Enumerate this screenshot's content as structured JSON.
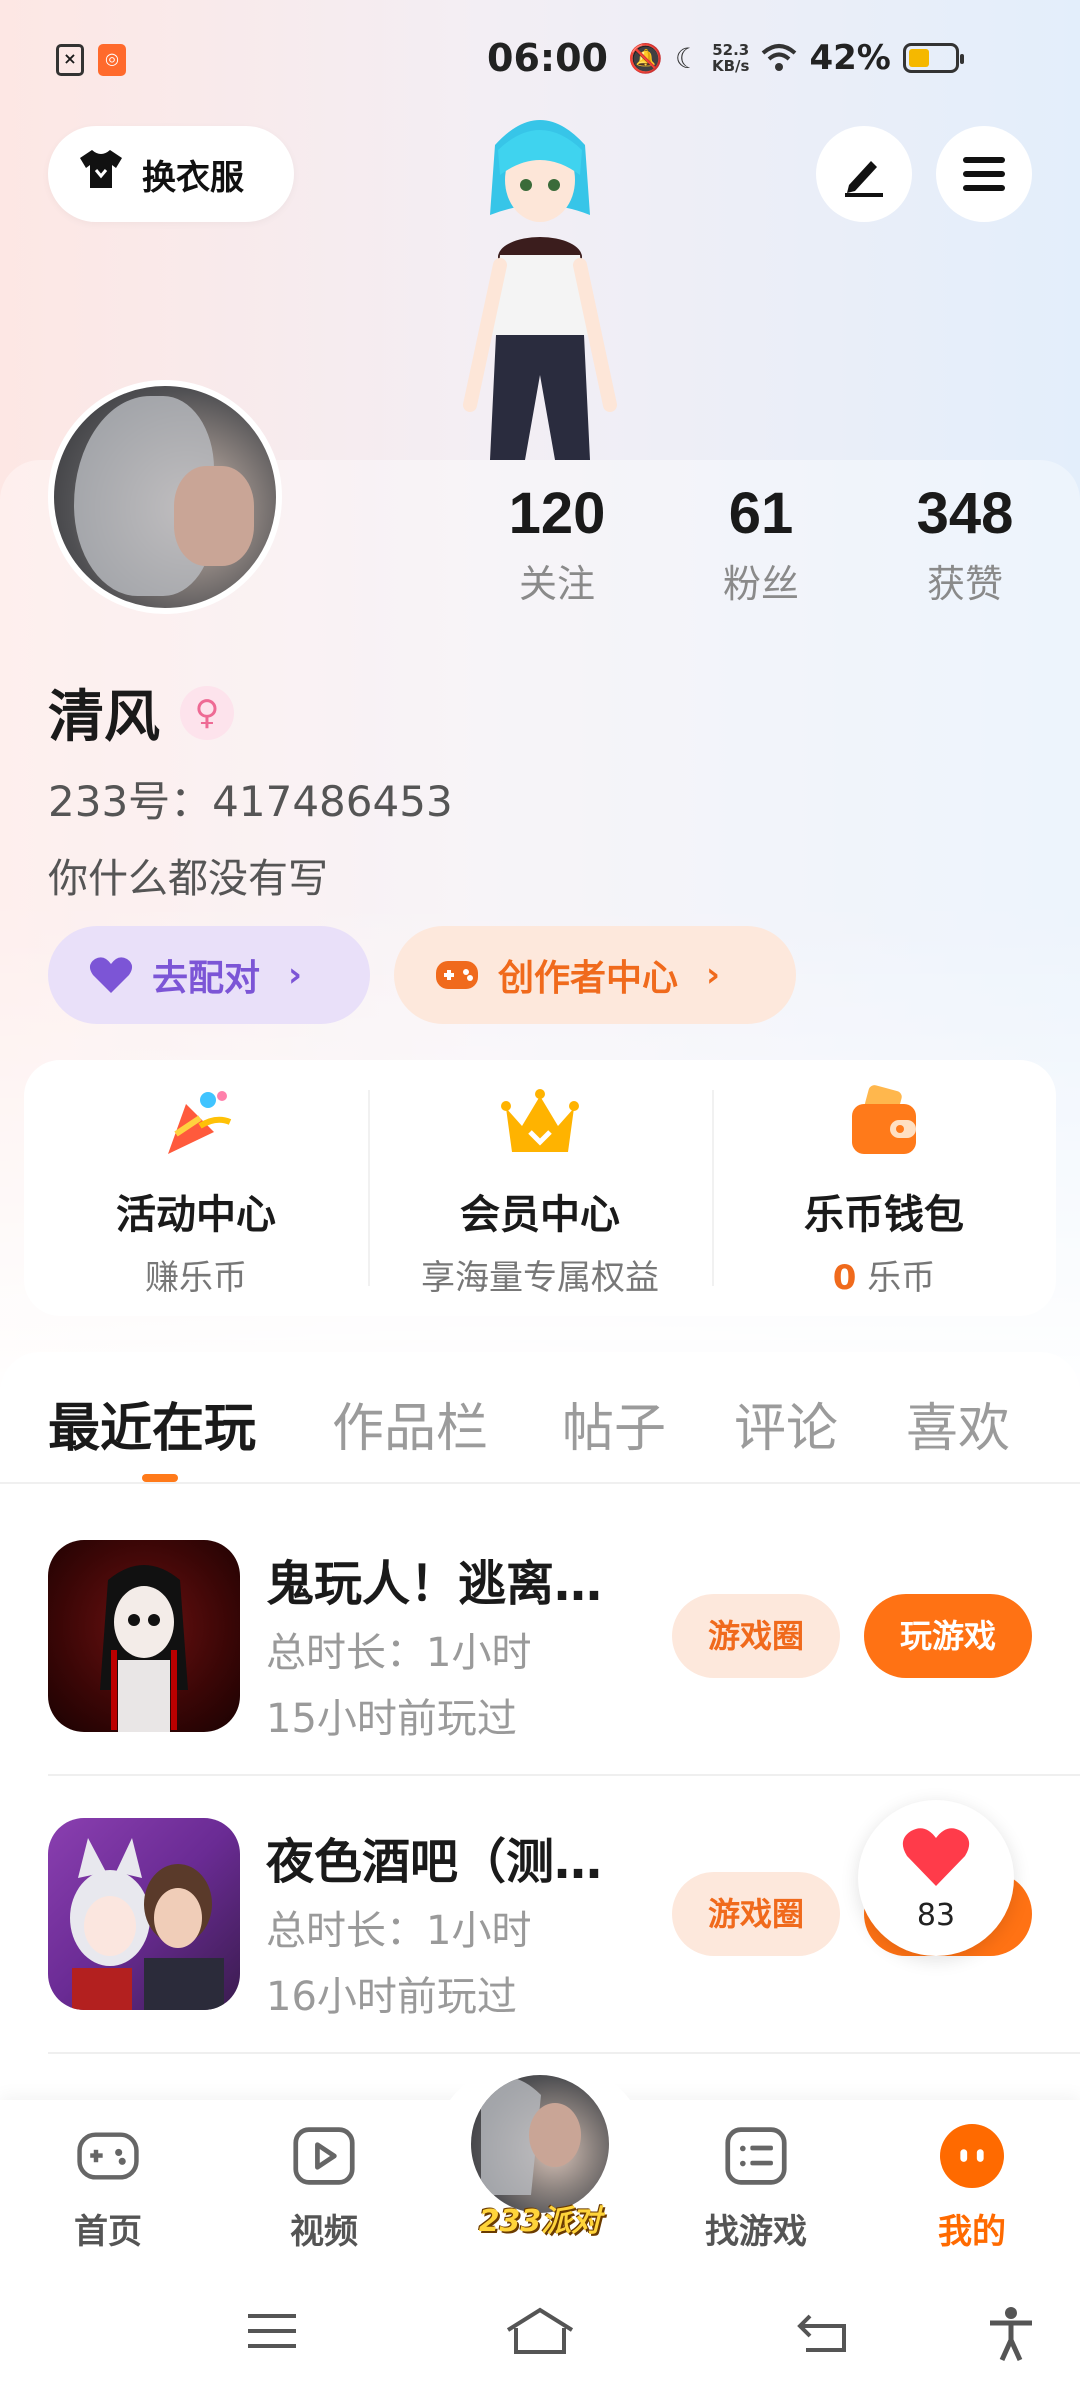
{
  "status_bar": {
    "time": "06:00",
    "net_speed_value": "52.3",
    "net_speed_unit": "KB/s",
    "battery_percent": "42%",
    "battery_level": 0.42
  },
  "header": {
    "outfit_label": "换衣服"
  },
  "profile": {
    "name": "清风",
    "gender_symbol": "♀",
    "uid_text": "233号：417486453",
    "bio": "你什么都没有写",
    "stats": [
      {
        "value": "120",
        "label": "关注"
      },
      {
        "value": "61",
        "label": "粉丝"
      },
      {
        "value": "348",
        "label": "获赞"
      }
    ],
    "match_label": "去配对",
    "creator_label": "创作者中心"
  },
  "features": [
    {
      "title": "活动中心",
      "sub": "赚乐币",
      "icon": "party-popper-icon"
    },
    {
      "title": "会员中心",
      "sub": "享海量专属权益",
      "icon": "crown-icon"
    },
    {
      "title": "乐币钱包",
      "sub_value": "0",
      "sub_unit": "乐币",
      "icon": "wallet-icon"
    }
  ],
  "tabs": [
    "最近在玩",
    "作品栏",
    "帖子",
    "评论",
    "喜欢"
  ],
  "games": [
    {
      "name": "鬼玩人！逃离…",
      "duration": "总时长：1小时",
      "last_played": "15小时前玩过",
      "circle_label": "游戏圈",
      "play_label": "玩游戏"
    },
    {
      "name": "夜色酒吧（测…",
      "duration": "总时长：1小时",
      "last_played": "16小时前玩过",
      "circle_label": "游戏圈",
      "play_label": "玩游戏"
    }
  ],
  "like_float": {
    "count": "83"
  },
  "bottom_nav": {
    "items": [
      {
        "label": "首页"
      },
      {
        "label": "视频"
      },
      {
        "label": "233派对"
      },
      {
        "label": "找游戏"
      },
      {
        "label": "我的"
      }
    ]
  },
  "colors": {
    "accent": "#ff6a00",
    "match_purple": "#7c55d6",
    "like_red": "#ff3b4a"
  }
}
